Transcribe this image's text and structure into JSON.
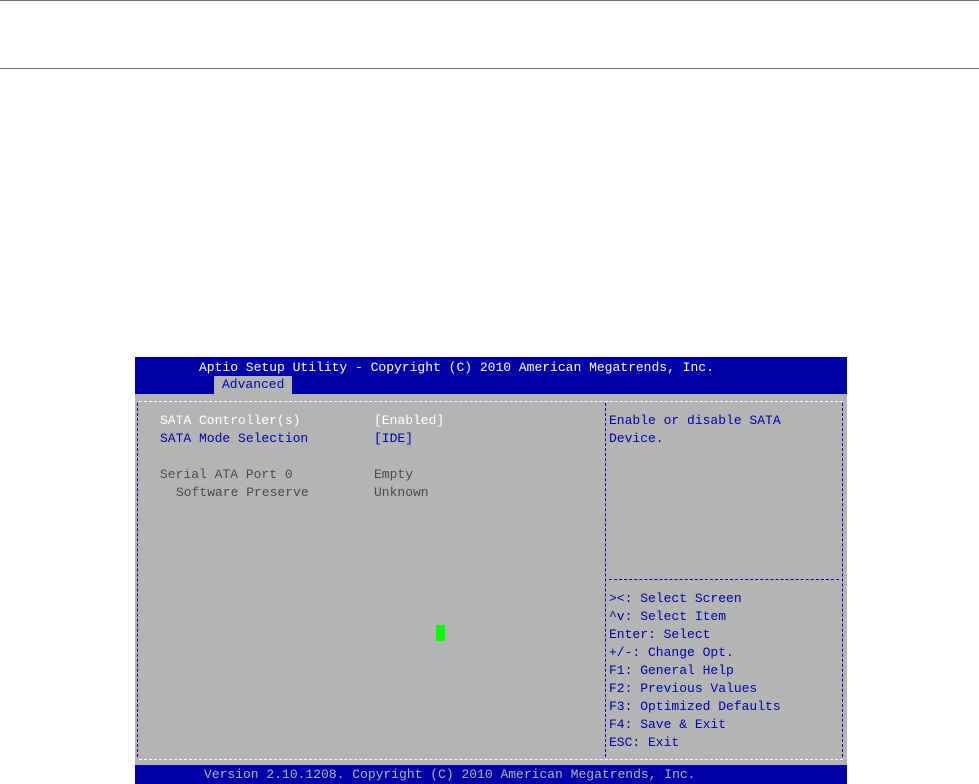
{
  "header": {
    "title": "Aptio Setup Utility - Copyright (C) 2010 American Megatrends, Inc.",
    "active_tab": "Advanced"
  },
  "settings": [
    {
      "label": "SATA Controller(s)",
      "value": "[Enabled]"
    },
    {
      "label": "SATA Mode Selection",
      "value": "[IDE]"
    }
  ],
  "ports": [
    {
      "label": "Serial ATA Port 0",
      "value": "Empty"
    },
    {
      "label": "Software Preserve",
      "value": "Unknown"
    }
  ],
  "help": {
    "description_line1": "Enable or disable SATA",
    "description_line2": "Device.",
    "keys": [
      "><: Select Screen",
      "^v: Select Item",
      "Enter: Select",
      "+/-: Change Opt.",
      "F1: General Help",
      "F2: Previous Values",
      "F3: Optimized Defaults",
      "F4: Save & Exit",
      "ESC: Exit"
    ]
  },
  "footer": {
    "version": "Version 2.10.1208. Copyright (C) 2010 American Megatrends, Inc."
  },
  "colors": {
    "header_bg": "#0000a8",
    "body_bg": "#b4b4b4",
    "cursor": "#00ff00"
  }
}
